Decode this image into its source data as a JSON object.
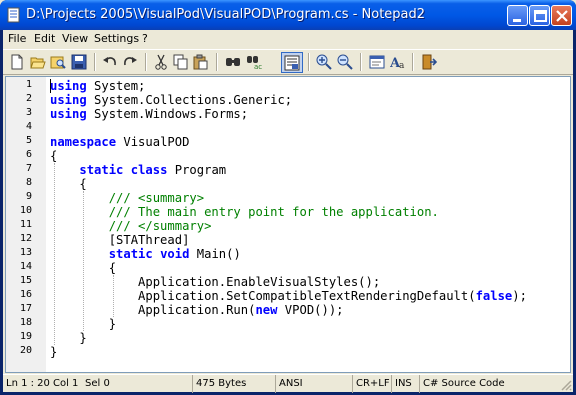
{
  "window": {
    "title": "D:\\Projects 2005\\VisualPod\\VisualPOD\\Program.cs - Notepad2"
  },
  "menu": [
    "File",
    "Edit",
    "View",
    "Settings",
    "?"
  ],
  "toolbar": {
    "icons": [
      "new-file-icon",
      "open-folder-icon",
      "browse-icon",
      "save-icon",
      "undo-icon",
      "redo-icon",
      "cut-icon",
      "copy-icon",
      "paste-icon",
      "find-icon",
      "replace-icon",
      "word-wrap-icon",
      "zoom-in-icon",
      "zoom-out-icon",
      "scheme-icon",
      "font-icon",
      "exit-icon"
    ]
  },
  "editor": {
    "line_numbers": [
      "1",
      "2",
      "3",
      "4",
      "5",
      "6",
      "7",
      "8",
      "9",
      "10",
      "11",
      "12",
      "13",
      "14",
      "15",
      "16",
      "17",
      "18",
      "19",
      "20"
    ],
    "lines": [
      "using System;",
      "using System.Collections.Generic;",
      "using System.Windows.Forms;",
      "",
      "namespace VisualPOD",
      "{",
      "    static class Program",
      "    {",
      "        /// <summary>",
      "        /// The main entry point for the application.",
      "        /// </summary>",
      "        [STAThread]",
      "        static void Main()",
      "        {",
      "            Application.EnableVisualStyles();",
      "            Application.SetCompatibleTextRenderingDefault(false);",
      "            Application.Run(new VPOD());",
      "        }",
      "    }",
      "}"
    ]
  },
  "status": {
    "position": "Ln 1 : 20",
    "column": "Col 1",
    "selection": "Sel 0",
    "size": "475 Bytes",
    "encoding": "ANSI",
    "line_endings": "CR+LF",
    "mode": "INS",
    "scheme": "C# Source Code"
  },
  "colors": {
    "keyword": "#0000ff",
    "comment": "#008000",
    "title_bar": "#0058e6"
  }
}
